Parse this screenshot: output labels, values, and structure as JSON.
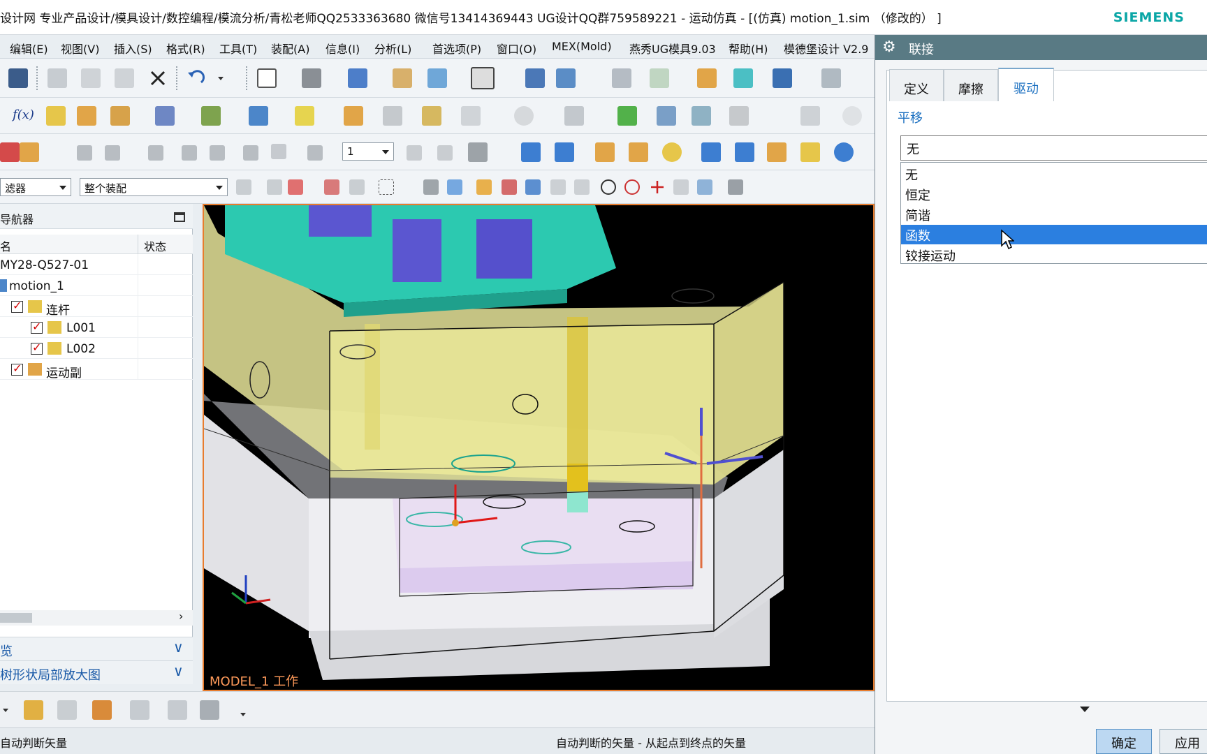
{
  "window": {
    "title": "设计网 专业产品设计/模具设计/数控编程/模流分析/青松老师QQ2533363680 微信号13414369443 UG设计QQ群759589221 - 运动仿真 - [(仿真) motion_1.sim （修改的） ]",
    "brand": "SIEMENS"
  },
  "menu": {
    "items": [
      "编辑(E)",
      "视图(V)",
      "插入(S)",
      "格式(R)",
      "工具(T)",
      "装配(A)",
      "信息(I)",
      "分析(L)",
      "首选项(P)",
      "窗口(O)",
      "MEX(Mold)",
      "燕秀UG模具9.03",
      "帮助(H)",
      "模德堡设计 V2.9"
    ]
  },
  "toolbar": {
    "frame_value": "1",
    "filter_label": "滤器",
    "scope_value": "整个装配",
    "fx_label": "f(x)"
  },
  "navigator": {
    "title": "导航器",
    "col_name": "名",
    "col_status": "状态",
    "rows": [
      {
        "label": "MY28-Q527-01"
      },
      {
        "label": "motion_1"
      },
      {
        "label": "连杆"
      },
      {
        "label": "L001"
      },
      {
        "label": "L002"
      },
      {
        "label": "运动副"
      }
    ],
    "panel1": "览",
    "panel2": "树形状局部放大图"
  },
  "viewport": {
    "label": "MODEL_1 工作"
  },
  "status": {
    "left": "自动判断矢量",
    "middle": "自动判断的矢量 - 从起点到终点的矢量"
  },
  "dialog": {
    "title": "联接",
    "tabs": [
      "定义",
      "摩擦",
      "驱动"
    ],
    "active_tab": "驱动",
    "section": "平移",
    "current_value": "无",
    "options": [
      "无",
      "恒定",
      "简谐",
      "函数",
      "铰接运动"
    ],
    "highlighted": "函数",
    "ok": "确定",
    "apply": "应用"
  },
  "colors": {
    "dialog_header": "#597a84",
    "selection": "#2b7fe0",
    "viewport_border": "#e87c2d",
    "link_blue": "#1a6fc0"
  }
}
